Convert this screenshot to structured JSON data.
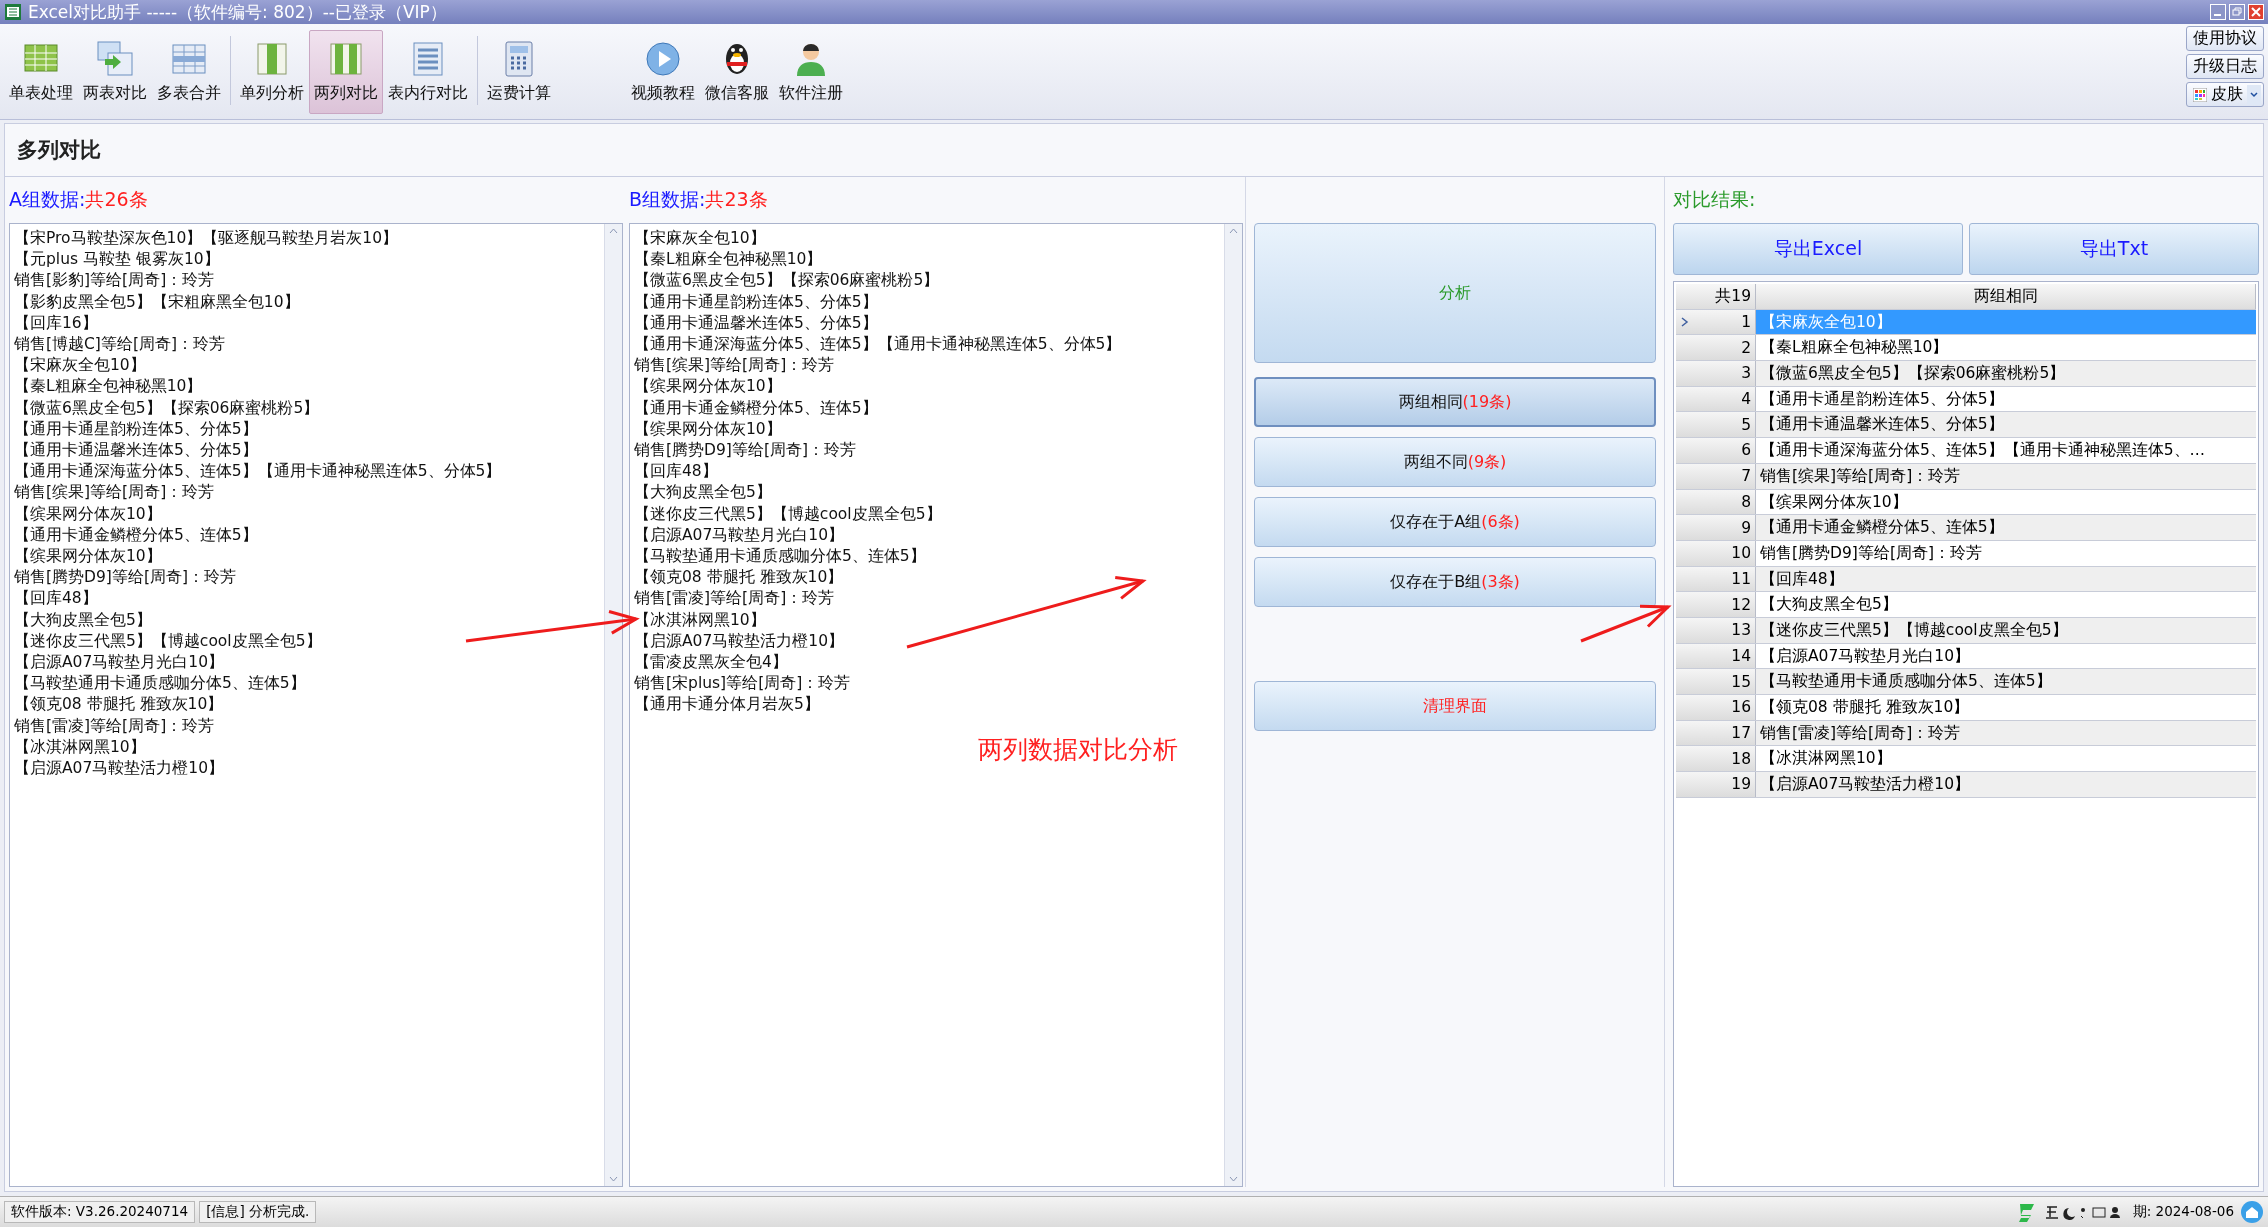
{
  "window": {
    "title": "Excel对比助手 -----（软件编号: 802）--已登录（VIP）"
  },
  "toolbar": {
    "items": [
      {
        "label": "单表处理",
        "selected": false
      },
      {
        "label": "两表对比",
        "selected": false
      },
      {
        "label": "多表合并",
        "selected": false
      },
      {
        "label": "单列分析",
        "selected": false
      },
      {
        "label": "两列对比",
        "selected": true
      },
      {
        "label": "表内行对比",
        "selected": false
      },
      {
        "label": "运费计算",
        "selected": false
      },
      {
        "label": "视频教程",
        "selected": false
      },
      {
        "label": "微信客服",
        "selected": false
      },
      {
        "label": "软件注册",
        "selected": false
      }
    ],
    "side_buttons": [
      "使用协议",
      "升级日志"
    ],
    "skin": {
      "label": "皮肤"
    }
  },
  "section_title": "多列对比",
  "group_a": {
    "label": "A组数据:",
    "count": "共26条",
    "lines": [
      "【宋Pro马鞍垫深灰色10】【驱逐舰马鞍垫月岩灰10】",
      "【元plus 马鞍垫 银雾灰10】",
      "销售[影豹]等给[周奇]：玲芳",
      "【影豹皮黑全包5】【宋粗麻黑全包10】",
      "【回库16】",
      "销售[博越C]等给[周奇]：玲芳",
      "【宋麻灰全包10】",
      "【秦L粗麻全包神秘黑10】",
      "【微蓝6黑皮全包5】【探索06麻蜜桃粉5】",
      "【通用卡通星韵粉连体5、分体5】",
      "【通用卡通温馨米连体5、分体5】",
      "【通用卡通深海蓝分体5、连体5】【通用卡通神秘黑连体5、分体5】",
      "销售[缤果]等给[周奇]：玲芳",
      "【缤果网分体灰10】",
      "【通用卡通金鳞橙分体5、连体5】",
      "【缤果网分体灰10】",
      "销售[腾势D9]等给[周奇]：玲芳",
      "【回库48】",
      "【大狗皮黑全包5】",
      "【迷你皮三代黑5】【博越cool皮黑全包5】",
      "【启源A07马鞍垫月光白10】",
      "【马鞍垫通用卡通质感咖分体5、连体5】",
      "【领克08 带腿托 雅致灰10】",
      "销售[雷凌]等给[周奇]：玲芳",
      "【冰淇淋网黑10】",
      "【启源A07马鞍垫活力橙10】"
    ]
  },
  "group_b": {
    "label": "B组数据:",
    "count": "共23条",
    "lines": [
      "【宋麻灰全包10】",
      "【秦L粗麻全包神秘黑10】",
      "【微蓝6黑皮全包5】【探索06麻蜜桃粉5】",
      "【通用卡通星韵粉连体5、分体5】",
      "【通用卡通温馨米连体5、分体5】",
      "【通用卡通深海蓝分体5、连体5】【通用卡通神秘黑连体5、分体5】",
      "销售[缤果]等给[周奇]：玲芳",
      "【缤果网分体灰10】",
      "【通用卡通金鳞橙分体5、连体5】",
      "【缤果网分体灰10】",
      "销售[腾势D9]等给[周奇]：玲芳",
      "【回库48】",
      "【大狗皮黑全包5】",
      "【迷你皮三代黑5】【博越cool皮黑全包5】",
      "【启源A07马鞍垫月光白10】",
      "【马鞍垫通用卡通质感咖分体5、连体5】",
      "【领克08 带腿托 雅致灰10】",
      "销售[雷凌]等给[周奇]：玲芳",
      "【冰淇淋网黑10】",
      "【启源A07马鞍垫活力橙10】",
      "【雷凌皮黑灰全包4】",
      "销售[宋plus]等给[周奇]：玲芳",
      "【通用卡通分体月岩灰5】"
    ]
  },
  "actions": [
    {
      "kind": "analyze",
      "label": "分析"
    },
    {
      "kind": "filter",
      "label": "两组相同",
      "count": "(19条)",
      "selected": true
    },
    {
      "kind": "filter",
      "label": "两组不同",
      "count": "(9条)",
      "selected": false
    },
    {
      "kind": "filter",
      "label": "仅存在于A组",
      "count": "(6条)",
      "selected": false
    },
    {
      "kind": "filter",
      "label": "仅存在于B组",
      "count": "(3条)",
      "selected": false
    },
    {
      "kind": "clear",
      "label": "清理界面"
    }
  ],
  "result": {
    "label": "对比结果:",
    "export_buttons": [
      "导出Excel",
      "导出Txt"
    ],
    "columns": [
      "共19",
      "两组相同"
    ],
    "rows": [
      {
        "index": "1",
        "text": "【宋麻灰全包10】",
        "selected": true
      },
      {
        "index": "2",
        "text": "【秦L粗麻全包神秘黑10】",
        "selected": false
      },
      {
        "index": "3",
        "text": "【微蓝6黑皮全包5】【探索06麻蜜桃粉5】",
        "selected": false
      },
      {
        "index": "4",
        "text": "【通用卡通星韵粉连体5、分体5】",
        "selected": false
      },
      {
        "index": "5",
        "text": "【通用卡通温馨米连体5、分体5】",
        "selected": false
      },
      {
        "index": "6",
        "text": "【通用卡通深海蓝分体5、连体5】【通用卡通神秘黑连体5、…",
        "selected": false
      },
      {
        "index": "7",
        "text": "销售[缤果]等给[周奇]：玲芳",
        "selected": false
      },
      {
        "index": "8",
        "text": "【缤果网分体灰10】",
        "selected": false
      },
      {
        "index": "9",
        "text": "【通用卡通金鳞橙分体5、连体5】",
        "selected": false
      },
      {
        "index": "10",
        "text": "销售[腾势D9]等给[周奇]：玲芳",
        "selected": false
      },
      {
        "index": "11",
        "text": "【回库48】",
        "selected": false
      },
      {
        "index": "12",
        "text": "【大狗皮黑全包5】",
        "selected": false
      },
      {
        "index": "13",
        "text": "【迷你皮三代黑5】【博越cool皮黑全包5】",
        "selected": false
      },
      {
        "index": "14",
        "text": "【启源A07马鞍垫月光白10】",
        "selected": false
      },
      {
        "index": "15",
        "text": "【马鞍垫通用卡通质感咖分体5、连体5】",
        "selected": false
      },
      {
        "index": "16",
        "text": "【领克08 带腿托 雅致灰10】",
        "selected": false
      },
      {
        "index": "17",
        "text": "销售[雷凌]等给[周奇]：玲芳",
        "selected": false
      },
      {
        "index": "18",
        "text": "【冰淇淋网黑10】",
        "selected": false
      },
      {
        "index": "19",
        "text": "【启源A07马鞍垫活力橙10】",
        "selected": false
      }
    ]
  },
  "annotation": {
    "text": "两列数据对比分析"
  },
  "status_bar": {
    "version": "软件版本: V3.26.20240714",
    "message": "[信息] 分析完成.",
    "expiry": "期: 2024-08-06"
  }
}
